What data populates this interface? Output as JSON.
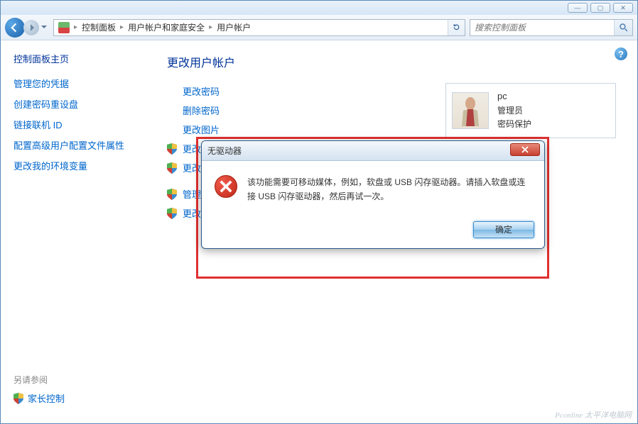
{
  "titlebar": {
    "min": "—",
    "max": "▢",
    "close": "✕"
  },
  "nav": {
    "crumbs": [
      "控制面板",
      "用户帐户和家庭安全",
      "用户帐户"
    ],
    "search_placeholder": "搜索控制面板"
  },
  "sidebar": {
    "home": "控制面板主页",
    "links": [
      "管理您的凭据",
      "创建密码重设盘",
      "链接联机 ID",
      "配置高级用户配置文件属性",
      "更改我的环境变量"
    ],
    "footer_label": "另请参阅",
    "footer_link": "家长控制"
  },
  "main": {
    "heading": "更改用户帐户",
    "actions": [
      {
        "label": "更改密码",
        "shield": false
      },
      {
        "label": "删除密码",
        "shield": false
      },
      {
        "label": "更改图片",
        "shield": false
      },
      {
        "label": "更改",
        "shield": true
      },
      {
        "label": "更改",
        "shield": true
      },
      {
        "label": "管理",
        "shield": true
      },
      {
        "label": "更改",
        "shield": true
      }
    ],
    "user": {
      "name": "pc",
      "role": "管理员",
      "pw": "密码保护"
    }
  },
  "dialog": {
    "title": "无驱动器",
    "message": "该功能需要可移动媒体，例如，软盘或 USB 闪存驱动器。请插入软盘或连接 USB 闪存驱动器，然后再试一次。",
    "ok": "确定"
  },
  "watermark": "Pconline 太平洋电脑网"
}
